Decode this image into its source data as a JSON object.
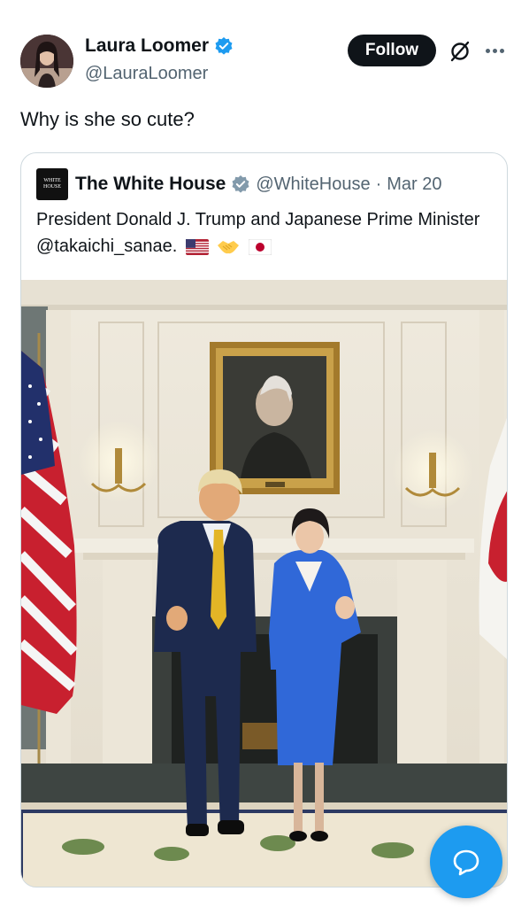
{
  "tweet": {
    "author": {
      "name": "Laura Loomer",
      "handle": "@LauraLoomer",
      "verified": true
    },
    "follow_label": "Follow",
    "text": "Why is she so cute?"
  },
  "quote": {
    "author": {
      "name": "The White House",
      "handle": "@WhiteHouse",
      "verified": true,
      "avatar_text_line1": "WHITE",
      "avatar_text_line2": "HOUSE"
    },
    "separator": "·",
    "date": "Mar 20",
    "text": "President Donald J. Trump and Japanese Prime Minister @takaichi_sanae.",
    "emojis": [
      "flag-us-icon",
      "handshake-icon",
      "flag-japan-icon"
    ]
  },
  "colors": {
    "accent": "#1d9bf0",
    "text_primary": "#0f1419",
    "text_secondary": "#536471",
    "border": "#cfd9de",
    "follow_bg": "#0f1419"
  }
}
